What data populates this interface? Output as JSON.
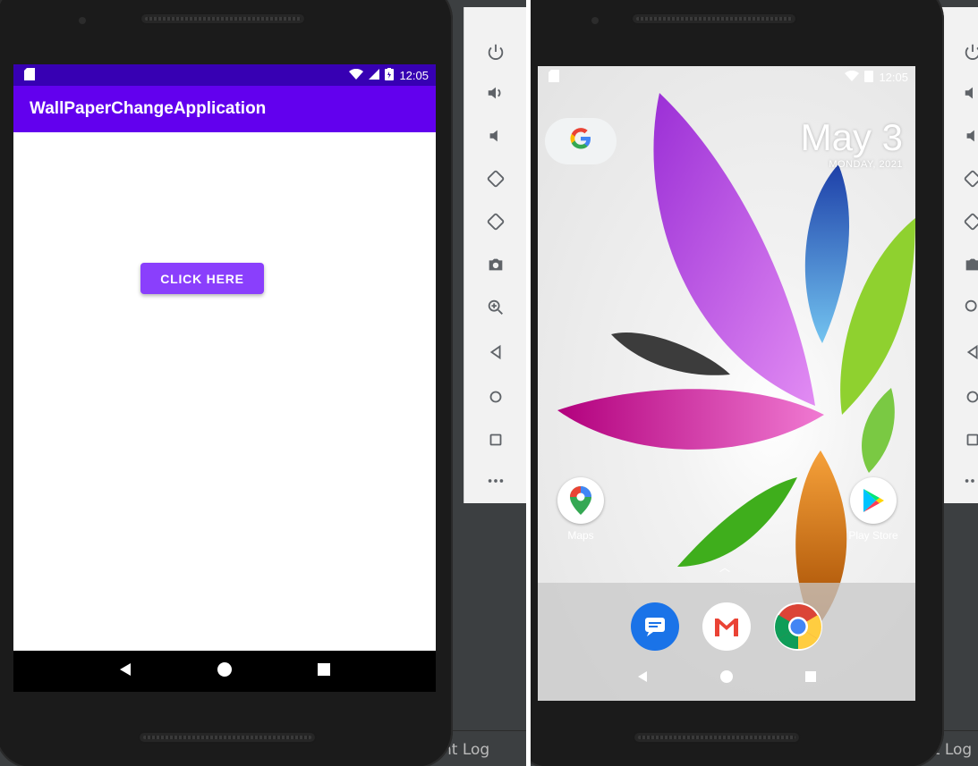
{
  "left_device": {
    "status": {
      "time": "12:05"
    },
    "app_title": "WallPaperChangeApplication",
    "button_label": "CLICK HERE",
    "colors": {
      "primary": "#6200ee",
      "status_bar": "#3700b3",
      "button": "#8a3ffc"
    }
  },
  "right_device": {
    "status": {
      "time": "12:05"
    },
    "google_icon": "google-g-icon",
    "date": {
      "day": "May 3",
      "weekday": "MONDAY, 2021"
    },
    "apps": [
      {
        "label": "Maps",
        "icon": "maps-icon"
      },
      {
        "label": "Play Store",
        "icon": "play-store-icon"
      }
    ],
    "dock": [
      "messages-icon",
      "gmail-icon",
      "chrome-icon"
    ]
  },
  "emulator_toolbar": {
    "buttons": [
      "power-icon",
      "volume-up-icon",
      "volume-down-icon",
      "rotate-left-icon",
      "rotate-right-icon",
      "camera-icon",
      "zoom-icon",
      "back-icon",
      "home-icon",
      "overview-icon",
      "more-icon"
    ]
  },
  "ide": {
    "bottom_tab_left": "nt Log",
    "bottom_tab_right": "nt Log"
  }
}
